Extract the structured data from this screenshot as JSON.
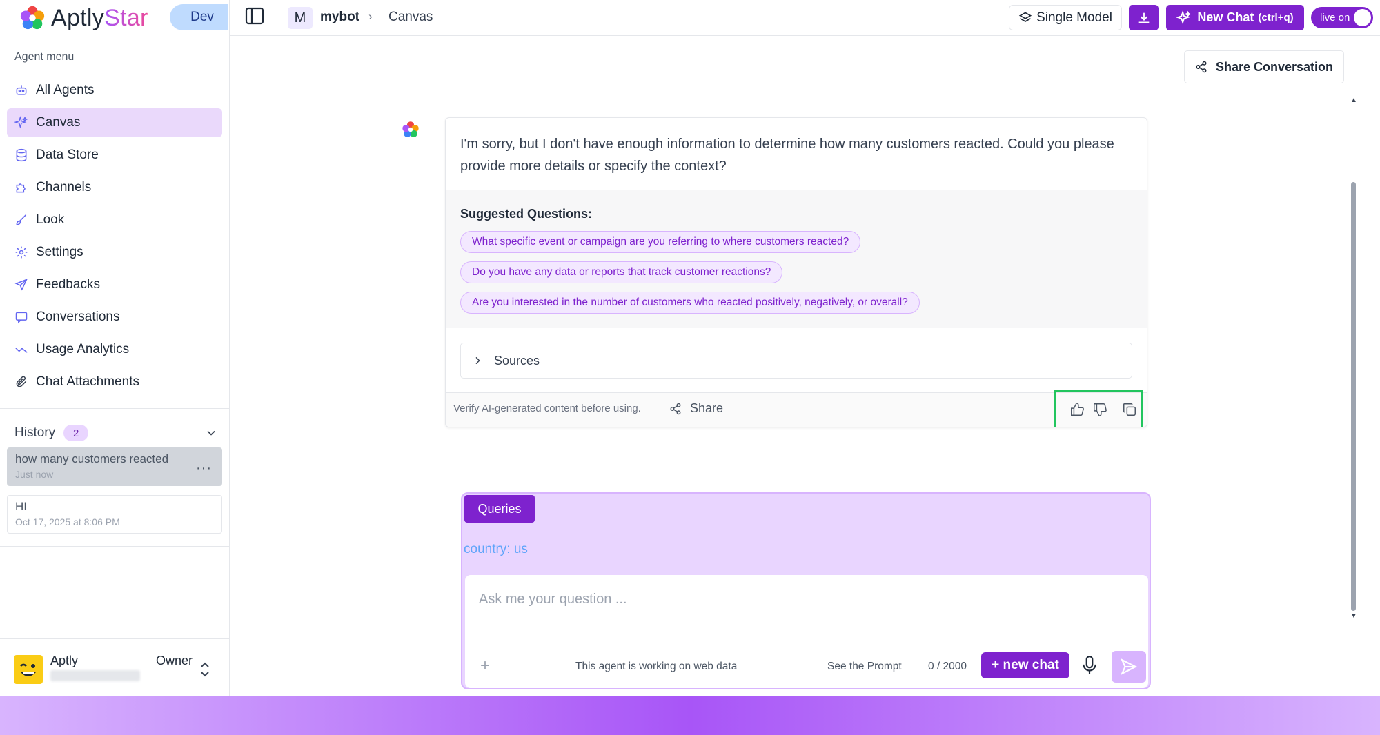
{
  "brand": {
    "name_a": "Aptly",
    "name_b": "Star",
    "env_badge": "Dev"
  },
  "sidebar": {
    "menu_title": "Agent menu",
    "items": [
      {
        "label": "All Agents",
        "icon": "robot-icon"
      },
      {
        "label": "Canvas",
        "icon": "sparkles-icon",
        "active": true
      },
      {
        "label": "Data Store",
        "icon": "database-icon"
      },
      {
        "label": "Channels",
        "icon": "puzzle-icon"
      },
      {
        "label": "Look",
        "icon": "brush-icon"
      },
      {
        "label": "Settings",
        "icon": "gear-icon"
      },
      {
        "label": "Feedbacks",
        "icon": "send-icon"
      },
      {
        "label": "Conversations",
        "icon": "chat-icon"
      },
      {
        "label": "Usage Analytics",
        "icon": "analytics-icon"
      },
      {
        "label": "Chat Attachments",
        "icon": "paperclip-icon"
      }
    ],
    "history": {
      "title": "History",
      "count": "2",
      "items": [
        {
          "title": "how many customers reacted",
          "time": "Just now",
          "more": "···"
        },
        {
          "title": "HI",
          "time": "Oct 17, 2025 at 8:06 PM"
        }
      ]
    },
    "user": {
      "name": "Aptly",
      "role": "Owner"
    }
  },
  "topbar": {
    "bot_initial": "M",
    "bot_name": "mybot",
    "separator": "›",
    "page": "Canvas",
    "single_model_label": "Single Model",
    "new_chat_label": "New Chat",
    "new_chat_hint": "(ctrl+q)",
    "live_label": "live on"
  },
  "share_conversation_label": "Share Conversation",
  "message": {
    "text": "I'm sorry, but I don't have enough information to determine how many customers reacted. Could you please provide more details or specify the context?",
    "suggested_title": "Suggested Questions:",
    "suggestions": [
      "What specific event or campaign are you referring to where customers reacted?",
      "Do you have any data or reports that track customer reactions?",
      "Are you interested in the number of customers who reacted positively, negatively, or overall?"
    ],
    "sources_label": "Sources",
    "verify_note": "Verify AI-generated content before using.",
    "share_label": "Share"
  },
  "composer": {
    "queries_label": "Queries",
    "country_tag": "country: us",
    "placeholder": "Ask me your question ...",
    "plus": "+",
    "web_note": "This agent is working on web data",
    "see_prompt": "See the Prompt",
    "char_count": "0 / 2000",
    "new_chat_label": "+ new chat"
  },
  "colors": {
    "accent": "#7e22ce",
    "accent_light": "#e9d5ff",
    "highlight_box": "#22c55e"
  }
}
